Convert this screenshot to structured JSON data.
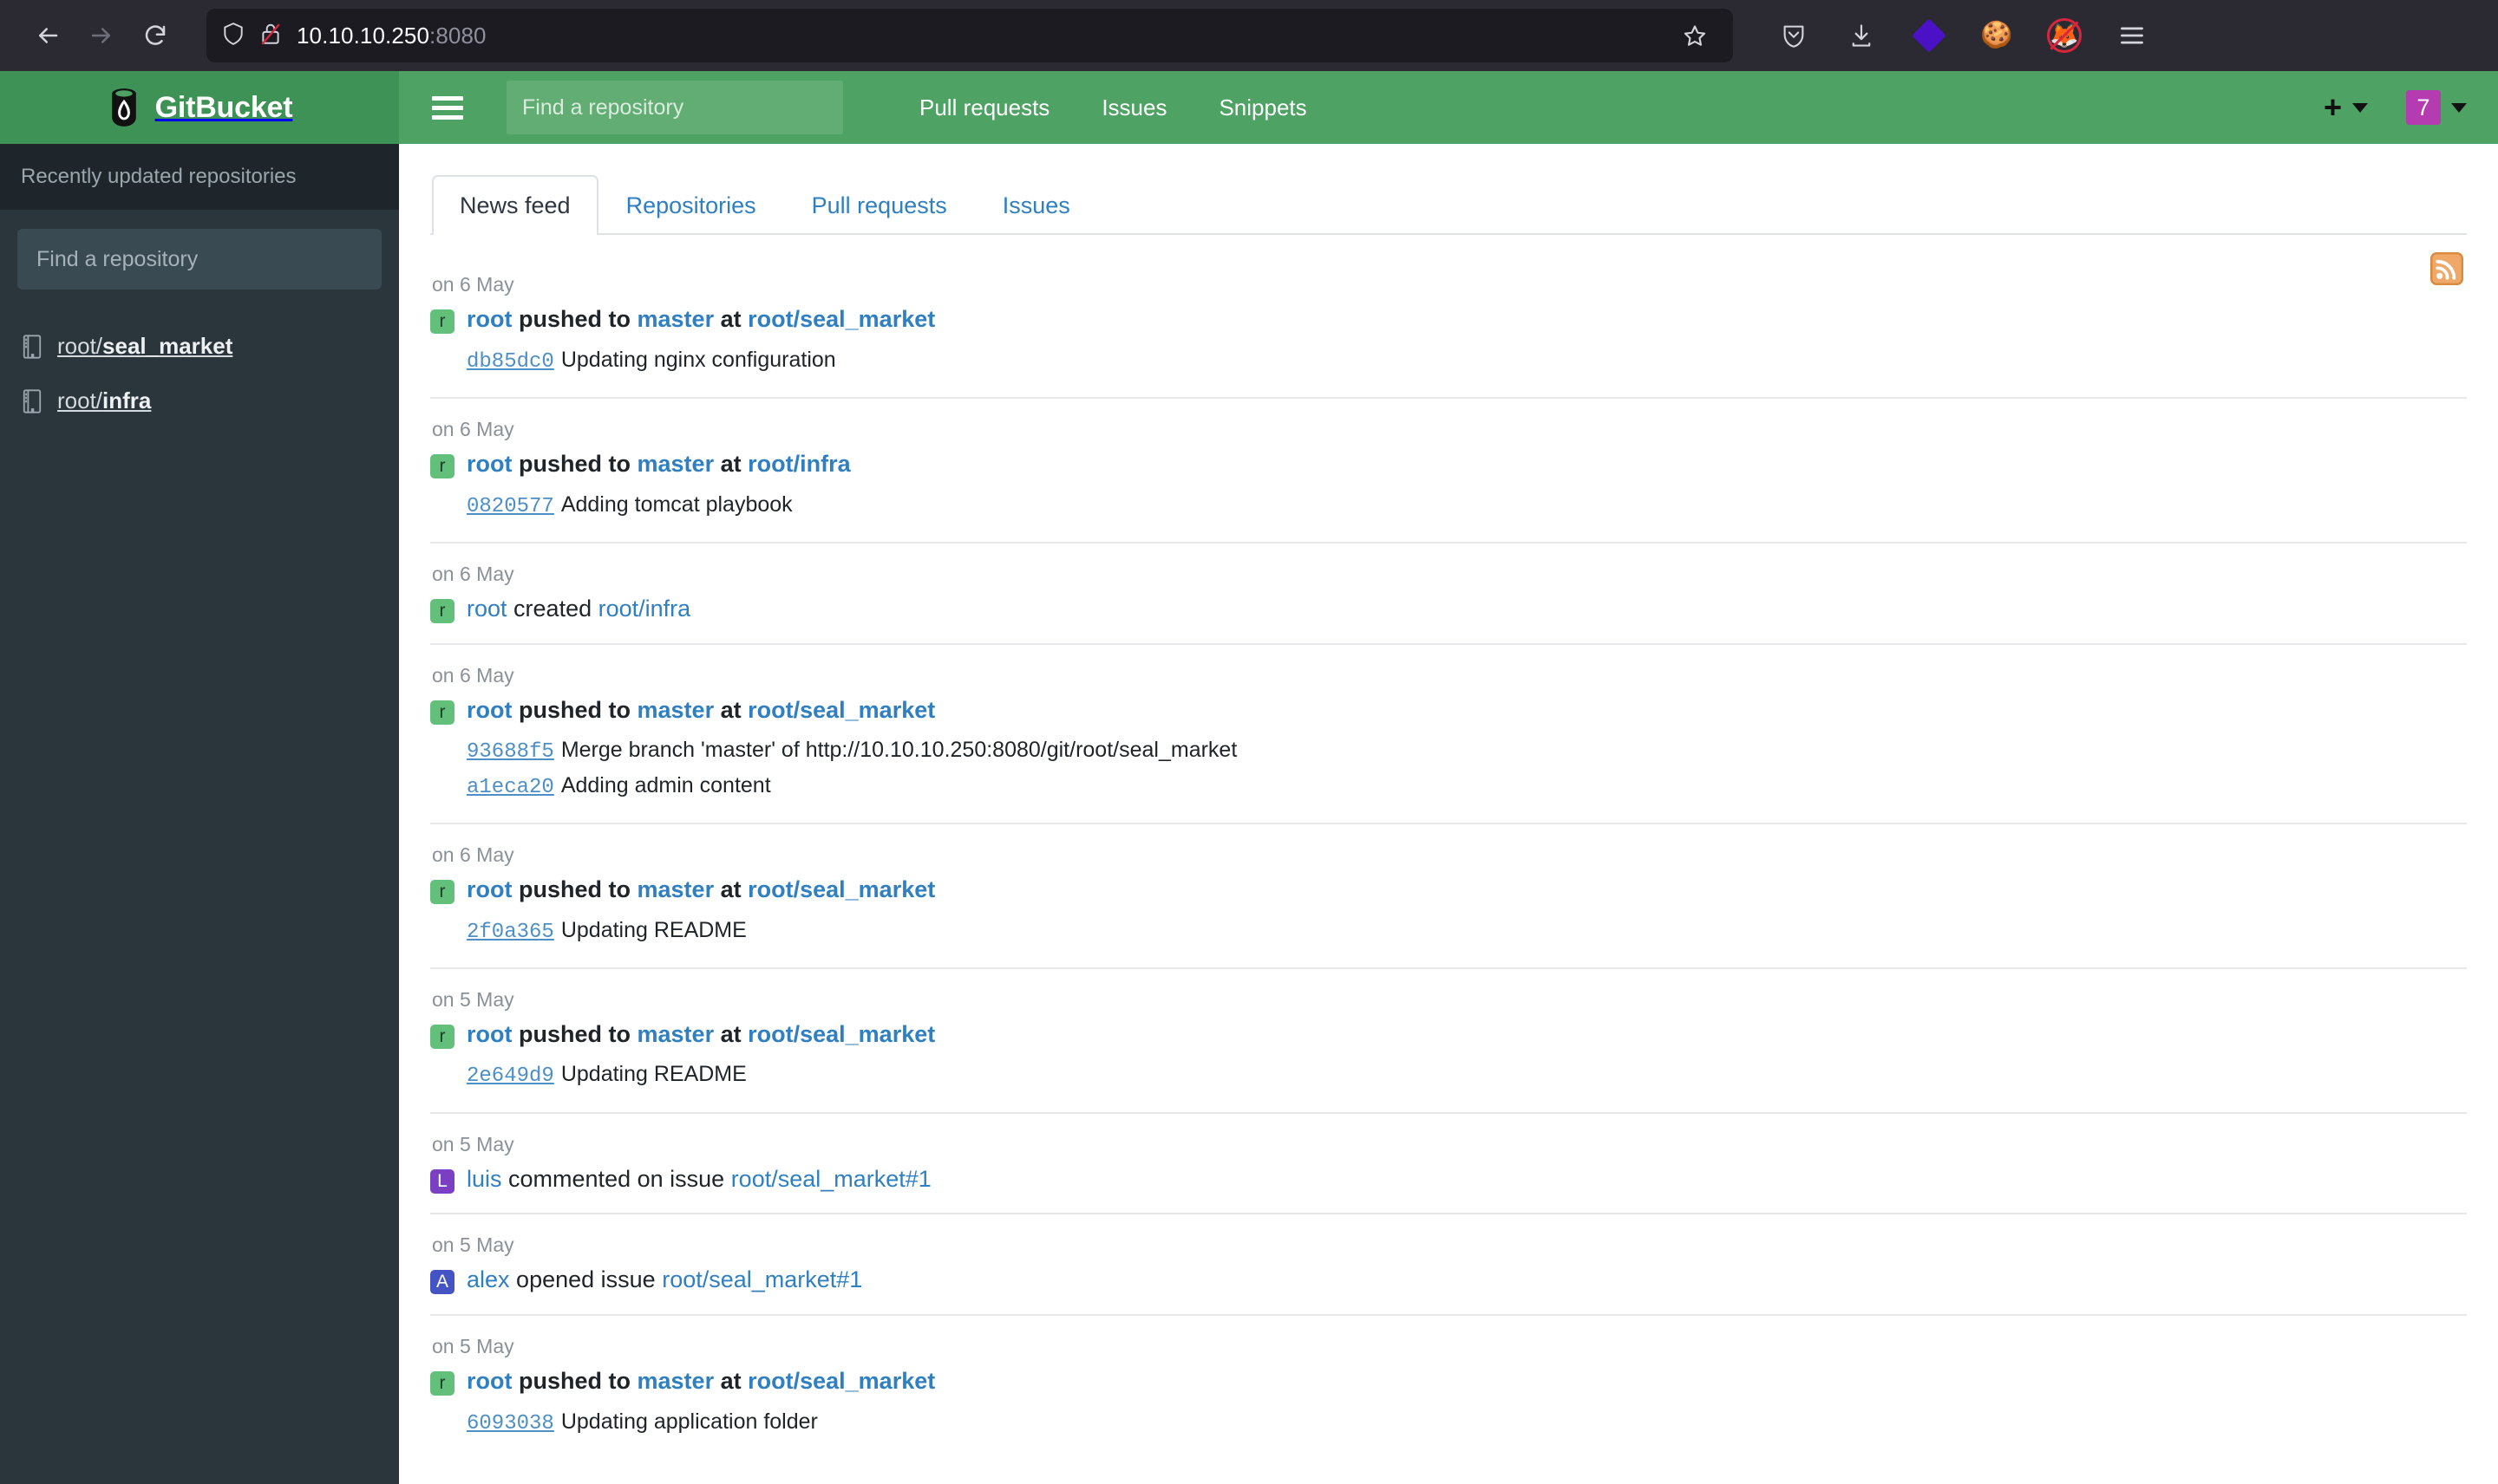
{
  "browser": {
    "back_label": "Back",
    "forward_label": "Forward",
    "reload_label": "Reload",
    "url_host": "10.10.10.250",
    "url_port": ":8080",
    "shield_label": "Tracking protection",
    "lock_label": "Connection is not secure",
    "bookmark_label": "Bookmark this page",
    "pocket_label": "Save to Pocket",
    "downloads_label": "Downloads",
    "extension_label": "Extension",
    "cookie_label": "Cookie manager",
    "fox_blocked_label": "Blocked",
    "menu_label": "Open application menu"
  },
  "header": {
    "brand": "GitBucket",
    "search_placeholder": "Find a repository",
    "search_value": "",
    "nav": [
      {
        "label": "Pull requests"
      },
      {
        "label": "Issues"
      },
      {
        "label": "Snippets"
      }
    ],
    "plus_label": "+",
    "user_initial": "7"
  },
  "sidebar": {
    "title": "Recently updated repositories",
    "search_placeholder": "Find a repository",
    "search_value": "",
    "repos": [
      {
        "owner": "root/",
        "name": "seal_market"
      },
      {
        "owner": "root/",
        "name": "infra"
      }
    ]
  },
  "tabs": [
    {
      "label": "News feed",
      "active": true
    },
    {
      "label": "Repositories",
      "active": false
    },
    {
      "label": "Pull requests",
      "active": false
    },
    {
      "label": "Issues",
      "active": false
    }
  ],
  "feed": {
    "rss_label": "RSS feed",
    "events": [
      {
        "date": "on 6 May",
        "avatar": "r",
        "avatar_color": "green",
        "actor": "root",
        "actor_bold": true,
        "verb": "pushed to",
        "verb_bold": true,
        "target": "master",
        "target_bold": true,
        "preposition": "at",
        "prep_bold": true,
        "repo": "root/seal_market",
        "repo_bold": true,
        "commits": [
          {
            "sha": "db85dc0",
            "message": "Updating nginx configuration"
          }
        ]
      },
      {
        "date": "on 6 May",
        "avatar": "r",
        "avatar_color": "green",
        "actor": "root",
        "actor_bold": true,
        "verb": "pushed to",
        "verb_bold": true,
        "target": "master",
        "target_bold": true,
        "preposition": "at",
        "prep_bold": true,
        "repo": "root/infra",
        "repo_bold": true,
        "commits": [
          {
            "sha": "0820577",
            "message": "Adding tomcat playbook"
          }
        ]
      },
      {
        "date": "on 6 May",
        "avatar": "r",
        "avatar_color": "green",
        "actor": "root",
        "actor_bold": false,
        "verb": "created",
        "verb_bold": false,
        "target": "",
        "target_bold": false,
        "preposition": "",
        "prep_bold": false,
        "repo": "root/infra",
        "repo_bold": false,
        "commits": []
      },
      {
        "date": "on 6 May",
        "avatar": "r",
        "avatar_color": "green",
        "actor": "root",
        "actor_bold": true,
        "verb": "pushed to",
        "verb_bold": true,
        "target": "master",
        "target_bold": true,
        "preposition": "at",
        "prep_bold": true,
        "repo": "root/seal_market",
        "repo_bold": true,
        "commits": [
          {
            "sha": "93688f5",
            "message": "Merge branch 'master' of http://10.10.10.250:8080/git/root/seal_market"
          },
          {
            "sha": "a1eca20",
            "message": "Adding admin content"
          }
        ]
      },
      {
        "date": "on 6 May",
        "avatar": "r",
        "avatar_color": "green",
        "actor": "root",
        "actor_bold": true,
        "verb": "pushed to",
        "verb_bold": true,
        "target": "master",
        "target_bold": true,
        "preposition": "at",
        "prep_bold": true,
        "repo": "root/seal_market",
        "repo_bold": true,
        "commits": [
          {
            "sha": "2f0a365",
            "message": "Updating README"
          }
        ]
      },
      {
        "date": "on 5 May",
        "avatar": "r",
        "avatar_color": "green",
        "actor": "root",
        "actor_bold": true,
        "verb": "pushed to",
        "verb_bold": true,
        "target": "master",
        "target_bold": true,
        "preposition": "at",
        "prep_bold": true,
        "repo": "root/seal_market",
        "repo_bold": true,
        "commits": [
          {
            "sha": "2e649d9",
            "message": "Updating README"
          }
        ]
      },
      {
        "date": "on 5 May",
        "avatar": "L",
        "avatar_color": "purple",
        "actor": "luis",
        "actor_bold": false,
        "verb": "commented on issue",
        "verb_bold": false,
        "target": "",
        "target_bold": false,
        "preposition": "",
        "prep_bold": false,
        "repo": "root/seal_market#1",
        "repo_bold": false,
        "commits": []
      },
      {
        "date": "on 5 May",
        "avatar": "A",
        "avatar_color": "indigo",
        "actor": "alex",
        "actor_bold": false,
        "verb": "opened issue",
        "verb_bold": false,
        "target": "",
        "target_bold": false,
        "preposition": "",
        "prep_bold": false,
        "repo": "root/seal_market#1",
        "repo_bold": false,
        "commits": []
      },
      {
        "date": "on 5 May",
        "avatar": "r",
        "avatar_color": "green",
        "actor": "root",
        "actor_bold": true,
        "verb": "pushed to",
        "verb_bold": true,
        "target": "master",
        "target_bold": true,
        "preposition": "at",
        "prep_bold": true,
        "repo": "root/seal_market",
        "repo_bold": true,
        "commits": [
          {
            "sha": "6093038",
            "message": "Updating application folder"
          }
        ]
      }
    ]
  }
}
